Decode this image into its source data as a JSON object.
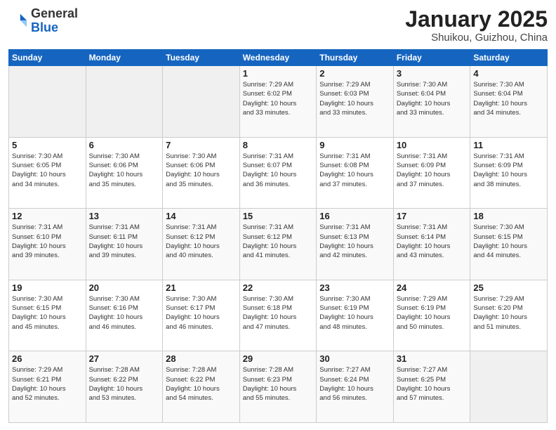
{
  "header": {
    "logo": {
      "general": "General",
      "blue": "Blue"
    },
    "title": "January 2025",
    "subtitle": "Shuikou, Guizhou, China"
  },
  "days_of_week": [
    "Sunday",
    "Monday",
    "Tuesday",
    "Wednesday",
    "Thursday",
    "Friday",
    "Saturday"
  ],
  "weeks": [
    [
      {
        "day": "",
        "info": ""
      },
      {
        "day": "",
        "info": ""
      },
      {
        "day": "",
        "info": ""
      },
      {
        "day": "1",
        "info": "Sunrise: 7:29 AM\nSunset: 6:02 PM\nDaylight: 10 hours\nand 33 minutes."
      },
      {
        "day": "2",
        "info": "Sunrise: 7:29 AM\nSunset: 6:03 PM\nDaylight: 10 hours\nand 33 minutes."
      },
      {
        "day": "3",
        "info": "Sunrise: 7:30 AM\nSunset: 6:04 PM\nDaylight: 10 hours\nand 33 minutes."
      },
      {
        "day": "4",
        "info": "Sunrise: 7:30 AM\nSunset: 6:04 PM\nDaylight: 10 hours\nand 34 minutes."
      }
    ],
    [
      {
        "day": "5",
        "info": "Sunrise: 7:30 AM\nSunset: 6:05 PM\nDaylight: 10 hours\nand 34 minutes."
      },
      {
        "day": "6",
        "info": "Sunrise: 7:30 AM\nSunset: 6:06 PM\nDaylight: 10 hours\nand 35 minutes."
      },
      {
        "day": "7",
        "info": "Sunrise: 7:30 AM\nSunset: 6:06 PM\nDaylight: 10 hours\nand 35 minutes."
      },
      {
        "day": "8",
        "info": "Sunrise: 7:31 AM\nSunset: 6:07 PM\nDaylight: 10 hours\nand 36 minutes."
      },
      {
        "day": "9",
        "info": "Sunrise: 7:31 AM\nSunset: 6:08 PM\nDaylight: 10 hours\nand 37 minutes."
      },
      {
        "day": "10",
        "info": "Sunrise: 7:31 AM\nSunset: 6:09 PM\nDaylight: 10 hours\nand 37 minutes."
      },
      {
        "day": "11",
        "info": "Sunrise: 7:31 AM\nSunset: 6:09 PM\nDaylight: 10 hours\nand 38 minutes."
      }
    ],
    [
      {
        "day": "12",
        "info": "Sunrise: 7:31 AM\nSunset: 6:10 PM\nDaylight: 10 hours\nand 39 minutes."
      },
      {
        "day": "13",
        "info": "Sunrise: 7:31 AM\nSunset: 6:11 PM\nDaylight: 10 hours\nand 39 minutes."
      },
      {
        "day": "14",
        "info": "Sunrise: 7:31 AM\nSunset: 6:12 PM\nDaylight: 10 hours\nand 40 minutes."
      },
      {
        "day": "15",
        "info": "Sunrise: 7:31 AM\nSunset: 6:12 PM\nDaylight: 10 hours\nand 41 minutes."
      },
      {
        "day": "16",
        "info": "Sunrise: 7:31 AM\nSunset: 6:13 PM\nDaylight: 10 hours\nand 42 minutes."
      },
      {
        "day": "17",
        "info": "Sunrise: 7:31 AM\nSunset: 6:14 PM\nDaylight: 10 hours\nand 43 minutes."
      },
      {
        "day": "18",
        "info": "Sunrise: 7:30 AM\nSunset: 6:15 PM\nDaylight: 10 hours\nand 44 minutes."
      }
    ],
    [
      {
        "day": "19",
        "info": "Sunrise: 7:30 AM\nSunset: 6:15 PM\nDaylight: 10 hours\nand 45 minutes."
      },
      {
        "day": "20",
        "info": "Sunrise: 7:30 AM\nSunset: 6:16 PM\nDaylight: 10 hours\nand 46 minutes."
      },
      {
        "day": "21",
        "info": "Sunrise: 7:30 AM\nSunset: 6:17 PM\nDaylight: 10 hours\nand 46 minutes."
      },
      {
        "day": "22",
        "info": "Sunrise: 7:30 AM\nSunset: 6:18 PM\nDaylight: 10 hours\nand 47 minutes."
      },
      {
        "day": "23",
        "info": "Sunrise: 7:30 AM\nSunset: 6:19 PM\nDaylight: 10 hours\nand 48 minutes."
      },
      {
        "day": "24",
        "info": "Sunrise: 7:29 AM\nSunset: 6:19 PM\nDaylight: 10 hours\nand 50 minutes."
      },
      {
        "day": "25",
        "info": "Sunrise: 7:29 AM\nSunset: 6:20 PM\nDaylight: 10 hours\nand 51 minutes."
      }
    ],
    [
      {
        "day": "26",
        "info": "Sunrise: 7:29 AM\nSunset: 6:21 PM\nDaylight: 10 hours\nand 52 minutes."
      },
      {
        "day": "27",
        "info": "Sunrise: 7:28 AM\nSunset: 6:22 PM\nDaylight: 10 hours\nand 53 minutes."
      },
      {
        "day": "28",
        "info": "Sunrise: 7:28 AM\nSunset: 6:22 PM\nDaylight: 10 hours\nand 54 minutes."
      },
      {
        "day": "29",
        "info": "Sunrise: 7:28 AM\nSunset: 6:23 PM\nDaylight: 10 hours\nand 55 minutes."
      },
      {
        "day": "30",
        "info": "Sunrise: 7:27 AM\nSunset: 6:24 PM\nDaylight: 10 hours\nand 56 minutes."
      },
      {
        "day": "31",
        "info": "Sunrise: 7:27 AM\nSunset: 6:25 PM\nDaylight: 10 hours\nand 57 minutes."
      },
      {
        "day": "",
        "info": ""
      }
    ]
  ]
}
